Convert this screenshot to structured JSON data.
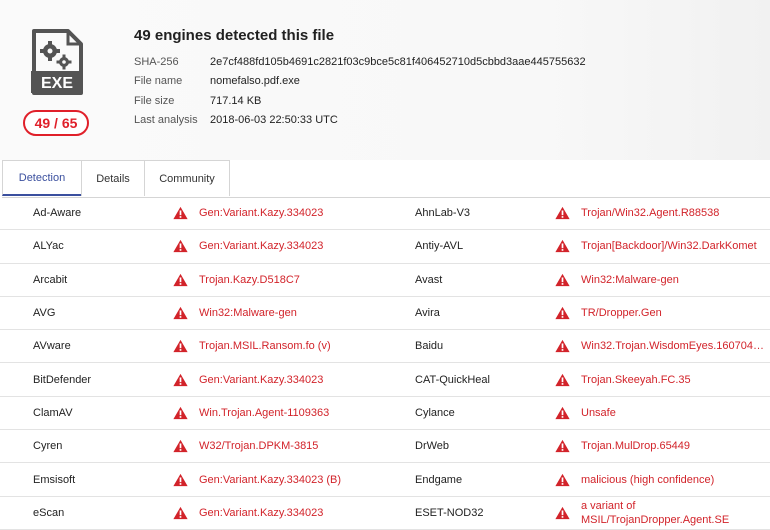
{
  "file_icon": {
    "label": "EXE",
    "icon": "exe-file-gears-icon"
  },
  "score": "49 / 65",
  "headline": "49 engines detected this file",
  "meta": [
    {
      "key": "SHA-256",
      "value": "2e7cf488fd105b4691c2821f03c9bce5c81f406452710d5cbbd3aae445755632"
    },
    {
      "key": "File name",
      "value": "nomefalso.pdf.exe"
    },
    {
      "key": "File size",
      "value": "717.14 KB"
    },
    {
      "key": "Last analysis",
      "value": "2018-06-03 22:50:33 UTC"
    }
  ],
  "tabs": [
    {
      "label": "Detection",
      "active": true
    },
    {
      "label": "Details",
      "active": false
    },
    {
      "label": "Community",
      "active": false
    }
  ],
  "colors": {
    "accent": "#3a4f9e",
    "danger": "#d2232a",
    "pill": "#e0202a"
  },
  "detections": [
    {
      "left": {
        "engine": "Ad-Aware",
        "result": "Gen:Variant.Kazy.334023"
      },
      "right": {
        "engine": "AhnLab-V3",
        "result": "Trojan/Win32.Agent.R88538"
      }
    },
    {
      "left": {
        "engine": "ALYac",
        "result": "Gen:Variant.Kazy.334023"
      },
      "right": {
        "engine": "Antiy-AVL",
        "result": "Trojan[Backdoor]/Win32.DarkKomet"
      }
    },
    {
      "left": {
        "engine": "Arcabit",
        "result": "Trojan.Kazy.D518C7"
      },
      "right": {
        "engine": "Avast",
        "result": "Win32:Malware-gen"
      }
    },
    {
      "left": {
        "engine": "AVG",
        "result": "Win32:Malware-gen"
      },
      "right": {
        "engine": "Avira",
        "result": "TR/Dropper.Gen"
      }
    },
    {
      "left": {
        "engine": "AVware",
        "result": "Trojan.MSIL.Ransom.fo (v)"
      },
      "right": {
        "engine": "Baidu",
        "result": "Win32.Trojan.WisdomEyes.16070401...."
      }
    },
    {
      "left": {
        "engine": "BitDefender",
        "result": "Gen:Variant.Kazy.334023"
      },
      "right": {
        "engine": "CAT-QuickHeal",
        "result": "Trojan.Skeeyah.FC.35"
      }
    },
    {
      "left": {
        "engine": "ClamAV",
        "result": "Win.Trojan.Agent-1109363"
      },
      "right": {
        "engine": "Cylance",
        "result": "Unsafe"
      }
    },
    {
      "left": {
        "engine": "Cyren",
        "result": "W32/Trojan.DPKM-3815"
      },
      "right": {
        "engine": "DrWeb",
        "result": "Trojan.MulDrop.65449"
      }
    },
    {
      "left": {
        "engine": "Emsisoft",
        "result": "Gen:Variant.Kazy.334023 (B)"
      },
      "right": {
        "engine": "Endgame",
        "result": "malicious (high confidence)"
      }
    },
    {
      "left": {
        "engine": "eScan",
        "result": "Gen:Variant.Kazy.334023"
      },
      "right": {
        "engine": "ESET-NOD32",
        "result": "a variant of MSIL/TrojanDropper.Agent.SE"
      }
    }
  ]
}
